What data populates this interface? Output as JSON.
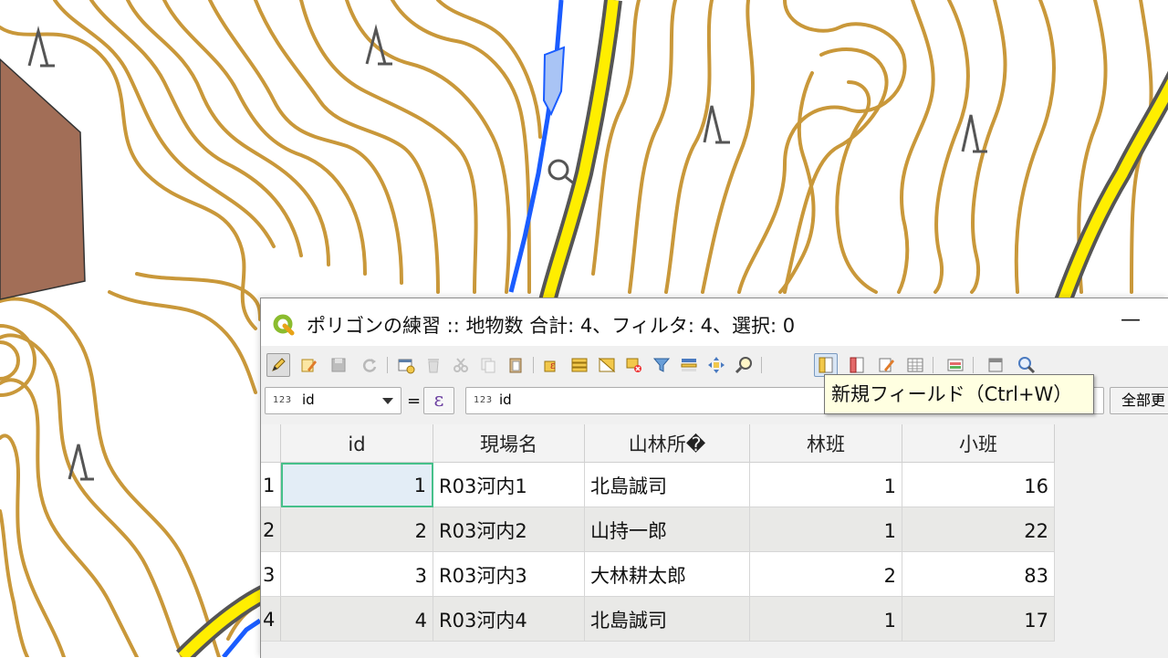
{
  "window": {
    "title": "ポリゴンの練習 :: 地物数 合計: 4、フィルタ: 4、選択: 0",
    "minimize_glyph": "—"
  },
  "colors": {
    "contour": "#c9983a",
    "road_fill": "#ffee00",
    "road_casing": "#555555",
    "stream": "#1a5cff",
    "polygon": "#a26e57",
    "current_cell_border": "#46c08a",
    "tooltip_bg": "#ffffe1"
  },
  "toolbar": {
    "icons": [
      "pencil-icon",
      "multi-edit-icon",
      "save-edits-icon",
      "reload-icon",
      "add-feature-icon",
      "delete-feature-icon",
      "cut-icon",
      "copy-icon",
      "paste-icon",
      "select-expression-icon",
      "select-all-icon",
      "invert-selection-icon",
      "deselect-icon",
      "filter-icon",
      "move-selection-top-icon",
      "pan-to-selection-icon",
      "zoom-to-selection-icon",
      "new-field-icon",
      "delete-field-icon",
      "field-calculator-icon",
      "conditional-formatting-icon",
      "dock-icon",
      "actions-icon",
      "zoom-map-icon"
    ]
  },
  "filter_bar": {
    "field_type_badge": "123",
    "field_value": "id",
    "equals": "=",
    "expression_glyph": "ε",
    "input_type_badge": "123",
    "input_value": "id",
    "update_all_label": "全部更"
  },
  "tooltip": {
    "text": "新規フィールド（Ctrl+W）"
  },
  "table": {
    "columns": [
      "id",
      "現場名",
      "山林所�",
      "林班",
      "小班"
    ],
    "rows": [
      {
        "row_number": "1",
        "id": "1",
        "genba": "R03河内1",
        "sanrin": "北島誠司",
        "rinpan": "1",
        "shohan": "16"
      },
      {
        "row_number": "2",
        "id": "2",
        "genba": "R03河内2",
        "sanrin": "山持一郎",
        "rinpan": "1",
        "shohan": "22"
      },
      {
        "row_number": "3",
        "id": "3",
        "genba": "R03河内3",
        "sanrin": "大林耕太郎",
        "rinpan": "2",
        "shohan": "83"
      },
      {
        "row_number": "4",
        "id": "4",
        "genba": "R03河内4",
        "sanrin": "北島誠司",
        "rinpan": "1",
        "shohan": "17"
      }
    ]
  }
}
